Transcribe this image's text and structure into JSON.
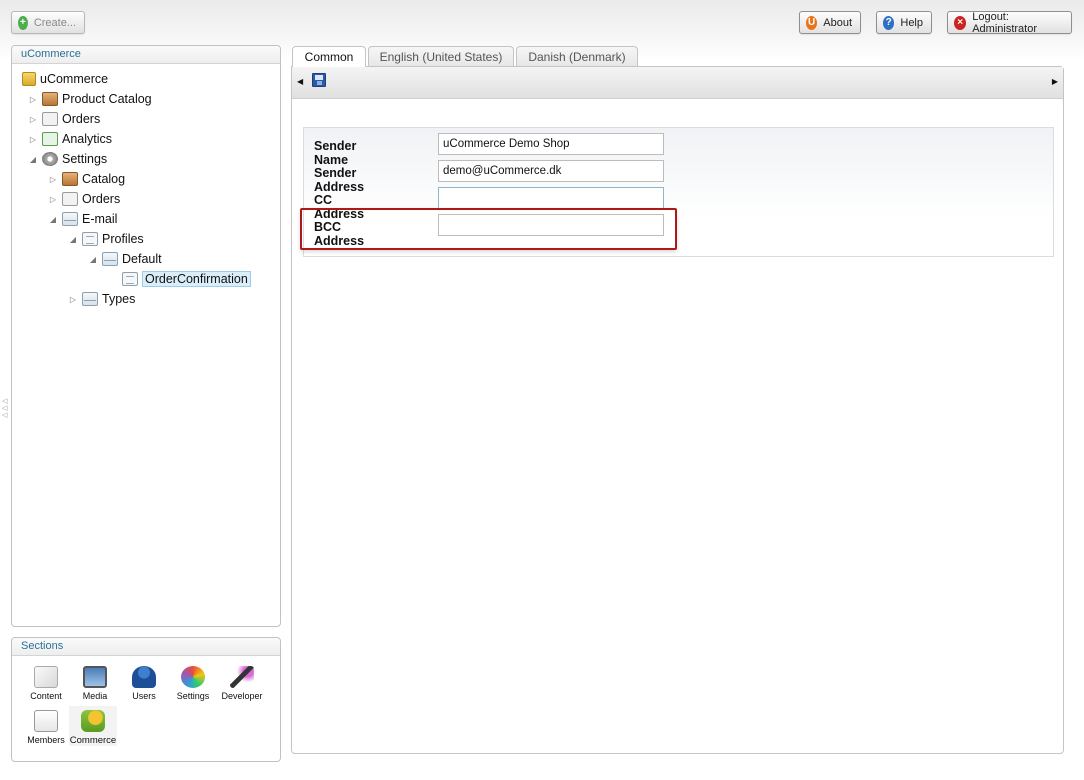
{
  "header": {
    "create_label": "Create...",
    "about_label": "About",
    "help_label": "Help",
    "logout_label": "Logout: Administrator"
  },
  "tree_panel": {
    "title": "uCommerce",
    "nodes": {
      "root": "uCommerce",
      "product_catalog": "Product Catalog",
      "orders": "Orders",
      "analytics": "Analytics",
      "settings": "Settings",
      "catalog": "Catalog",
      "settings_orders": "Orders",
      "email": "E-mail",
      "profiles": "Profiles",
      "default": "Default",
      "order_confirmation": "OrderConfirmation",
      "types": "Types"
    }
  },
  "sections_panel": {
    "title": "Sections",
    "items": [
      {
        "label": "Content",
        "icon": "pencil-doc-icon"
      },
      {
        "label": "Media",
        "icon": "monitor-icon"
      },
      {
        "label": "Users",
        "icon": "user-icon"
      },
      {
        "label": "Settings",
        "icon": "color-wheel-icon"
      },
      {
        "label": "Developer",
        "icon": "magic-wand-icon"
      },
      {
        "label": "Members",
        "icon": "member-card-icon"
      },
      {
        "label": "Commerce",
        "icon": "commerce-icon"
      }
    ]
  },
  "tabs": [
    {
      "label": "Common",
      "active": true
    },
    {
      "label": "English (United States)",
      "active": false
    },
    {
      "label": "Danish (Denmark)",
      "active": false
    }
  ],
  "form": {
    "sender_name": {
      "label": "Sender Name",
      "value": "uCommerce Demo Shop"
    },
    "sender_address": {
      "label": "Sender Address",
      "value": "demo@uCommerce.dk"
    },
    "cc_address": {
      "label": "CC Address",
      "value": ""
    },
    "bcc_address": {
      "label": "BCC Address",
      "value": ""
    }
  },
  "colors": {
    "accent": "#2a6f97",
    "highlight": "#b01818",
    "selected": "#daeefa"
  }
}
